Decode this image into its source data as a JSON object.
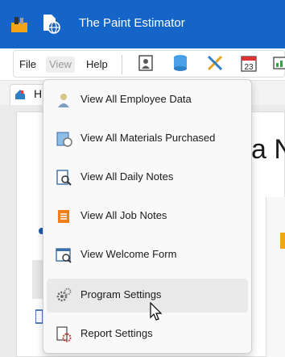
{
  "window": {
    "title": "The Paint Estimator",
    "accent": "#1565c8"
  },
  "menubar": {
    "items": [
      "File",
      "View",
      "Help"
    ],
    "active": "View"
  },
  "toolbar": {
    "icons": [
      "employee-card-icon",
      "database-icon",
      "pencil-ruler-icon",
      "calendar-23-icon",
      "chart-icon"
    ],
    "calendar_label": "23"
  },
  "tabs": {
    "home_partial": "H"
  },
  "background": {
    "partial_heading": "a N"
  },
  "dropdown": {
    "items": [
      {
        "label": "View All Employee Data",
        "icon": "employee-data-icon"
      },
      {
        "label": "View All Materials Purchased",
        "icon": "materials-icon"
      },
      {
        "label": "View All Daily Notes",
        "icon": "daily-notes-icon"
      },
      {
        "label": "View All Job Notes",
        "icon": "job-notes-icon"
      },
      {
        "label": "View Welcome Form",
        "icon": "welcome-form-icon"
      },
      {
        "label": "Program Settings",
        "icon": "gear-icon"
      },
      {
        "label": "Report Settings",
        "icon": "report-settings-icon"
      }
    ],
    "hovered": "Program Settings"
  }
}
